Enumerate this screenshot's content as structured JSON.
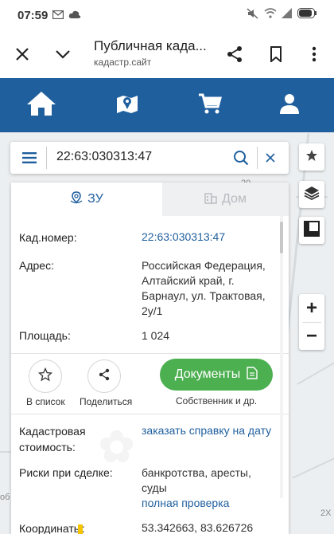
{
  "status": {
    "time": "07:59",
    "icons": [
      "gmail-icon",
      "cloud-icon",
      "mute-icon",
      "wifi-icon",
      "signal-icon",
      "battery-icon"
    ]
  },
  "browser": {
    "title": "Публичная када...",
    "url": "кадастр.сайт",
    "icons": [
      "close-icon",
      "chevron-down-icon",
      "share-icon",
      "bookmark-icon",
      "more-icon"
    ]
  },
  "nav": {
    "icons": [
      "home-icon",
      "map-marker-icon",
      "cart-icon",
      "user-icon"
    ],
    "color": "#1f5f9e"
  },
  "search": {
    "value": "22:63:030313:47"
  },
  "tabs": [
    {
      "label": "ЗУ",
      "active": true
    },
    {
      "label": "Дом",
      "active": false
    }
  ],
  "info": {
    "kad_label": "Кад.номер:",
    "kad_value": "22:63:030313:47",
    "addr_label": "Адрес:",
    "addr_value": "Российская Федерация, Алтайский край, г. Барнаул, ул. Трактовая, 2у/1",
    "area_label": "Площадь:",
    "area_value": "1 024"
  },
  "actions": {
    "list_label": "В список",
    "share_label": "Поделиться",
    "docs_label": "Документы",
    "docs_caption": "Собственник и др."
  },
  "details": {
    "cost_label": "Кадастровая стоимость:",
    "cost_link": "заказать справку на дату",
    "risk_label": "Риски при сделке:",
    "risk_value": "банкротства, аресты, суды",
    "risk_link": "полная проверка",
    "coords_label": "Координаты:",
    "coords_value": "53.342663, 83.626726"
  },
  "map": {
    "zoom_in": "+",
    "zoom_out": "−",
    "label_2x": "2X",
    "label_edge": "об",
    "label_top": "20"
  },
  "colors": {
    "brand": "#1f5f9e",
    "green": "#4caf50"
  }
}
